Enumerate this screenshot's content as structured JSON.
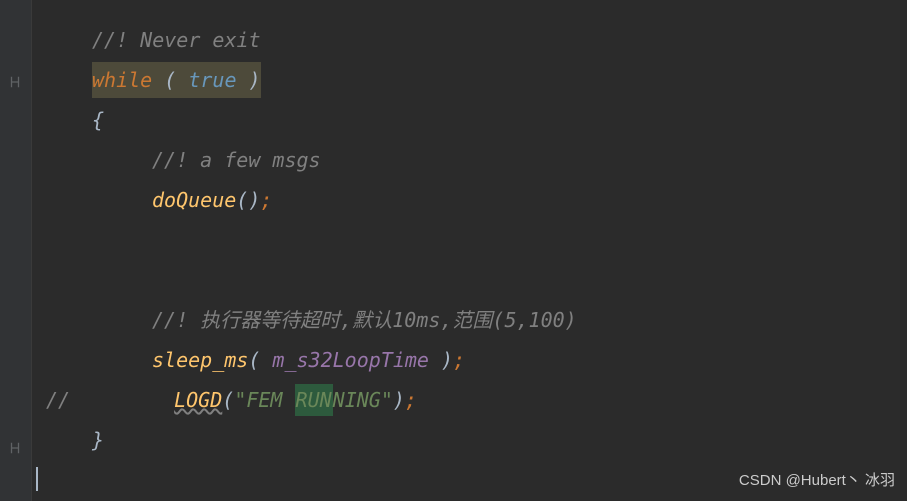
{
  "code": {
    "line1_comment": "//! Never exit",
    "line2_while": "while",
    "line2_paren_open": " ( ",
    "line2_true": "true",
    "line2_paren_close": " )",
    "line3_brace": "{",
    "line4_comment": "//! a few msgs",
    "line5_func": "doQueue",
    "line5_rest": "()",
    "line5_semi": ";",
    "line6_comment": "//! 执行器等待超时,默认10ms,范围(5,100)",
    "line7_func": "sleep_ms",
    "line7_paren_open": "( ",
    "line7_arg": "m_s32LoopTime",
    "line7_paren_close": " )",
    "line7_semi": ";",
    "line8_slash": "//",
    "line8_func": "LOGD",
    "line8_paren_open": "(",
    "line8_str_open": "\"FEM ",
    "line8_str_run": "RUN",
    "line8_str_end": "NING\"",
    "line8_paren_close": ")",
    "line8_semi": ";",
    "line9_brace": "}"
  },
  "watermark": "CSDN @Hubert丶 冰羽"
}
